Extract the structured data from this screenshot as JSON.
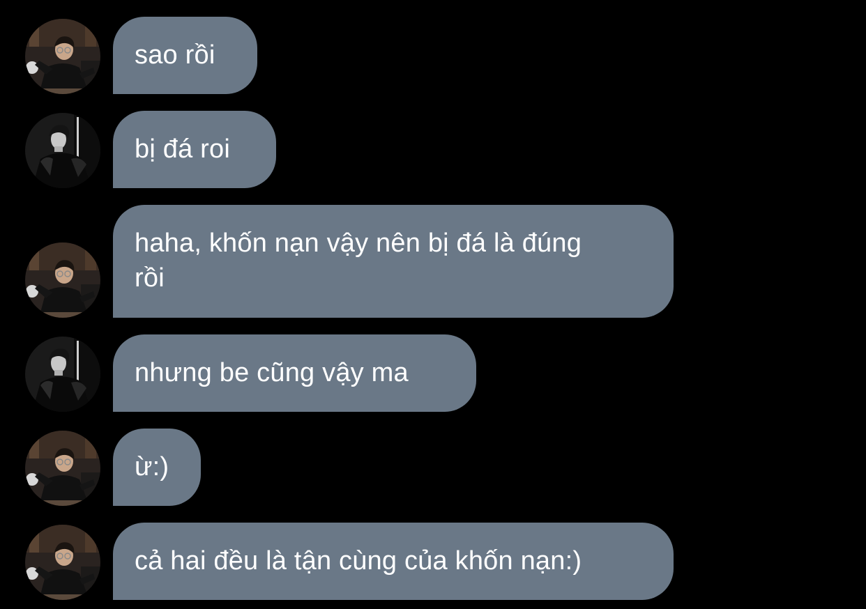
{
  "chat": {
    "messages": [
      {
        "sender": "a",
        "text": "sao rồi"
      },
      {
        "sender": "b",
        "text": "bị đá roi"
      },
      {
        "sender": "a",
        "text": "haha, khốn nạn vậy nên bị đá là đúng\nrồi"
      },
      {
        "sender": "b",
        "text": "nhưng be cũng vậy ma"
      },
      {
        "sender": "a",
        "text": "ừ:)"
      },
      {
        "sender": "a",
        "text": "cả hai đều là tận cùng của khốn nạn:)"
      }
    ]
  },
  "colors": {
    "background": "#000000",
    "bubble": "#6a7887",
    "text": "#ffffff"
  }
}
